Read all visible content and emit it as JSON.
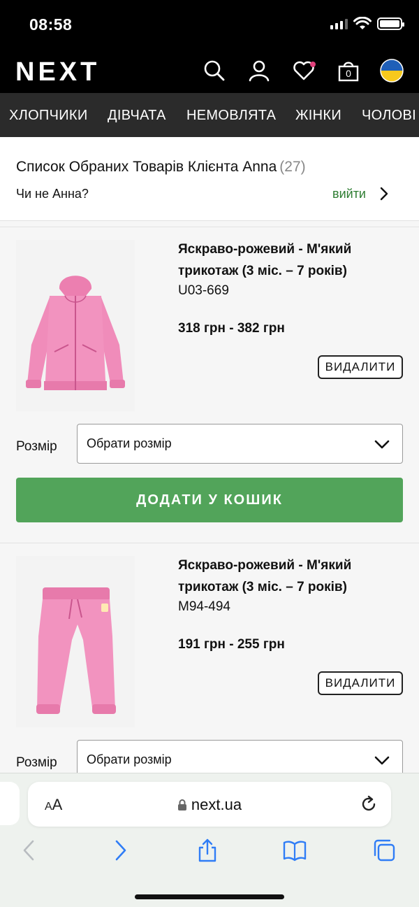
{
  "status_bar": {
    "time": "08:58"
  },
  "header": {
    "logo": "NEXT",
    "icons": [
      "search-icon",
      "account-icon",
      "wishlist-heart-icon",
      "shopping-bag-icon",
      "ukraine-flag-icon"
    ],
    "bag_count": "0",
    "colors": {
      "background": "#000000",
      "wishlist_dot": "#e0407b",
      "flag_blue": "#1f5fb8",
      "flag_yellow": "#f7c91c"
    }
  },
  "categories": [
    "ХЛОПЧИКИ",
    "ДІВЧАТА",
    "НЕМОВЛЯТА",
    "ЖІНКИ",
    "ЧОЛОВІ"
  ],
  "wishlist": {
    "title": "Список Обраних Товарів Клієнта Anna",
    "count": "(27)",
    "not_you": "Чи не Анна?",
    "logout": "вийти"
  },
  "items": [
    {
      "name": "Яскраво-рожевий - М'який трикотаж (3 міс. – 7 років)",
      "code": "U03-669",
      "price": "318 грн - 382 грн",
      "remove_label": "ВИДАЛИТИ",
      "size_label": "Розмір",
      "size_value": "Обрати розмір",
      "add_label": "ДОДАТИ У КОШИК",
      "image": "pink-zip-hoodie"
    },
    {
      "name": "Яскраво-рожевий - М'який трикотаж (3 міс. – 7 років)",
      "code": "M94-494",
      "price": "191 грн - 255 грн",
      "remove_label": "ВИДАЛИТИ",
      "size_label": "Розмір",
      "size_value": "Обрати розмір",
      "image": "pink-joggers"
    }
  ],
  "browser": {
    "aa": "AA",
    "url": "next.ua",
    "toolbar": [
      "back-icon",
      "forward-icon",
      "share-icon",
      "bookmarks-icon",
      "tabs-icon"
    ]
  },
  "colors": {
    "accent_green": "#52a45a",
    "logout_green": "#2e7d32",
    "nav_bg": "#2b2b2b"
  }
}
